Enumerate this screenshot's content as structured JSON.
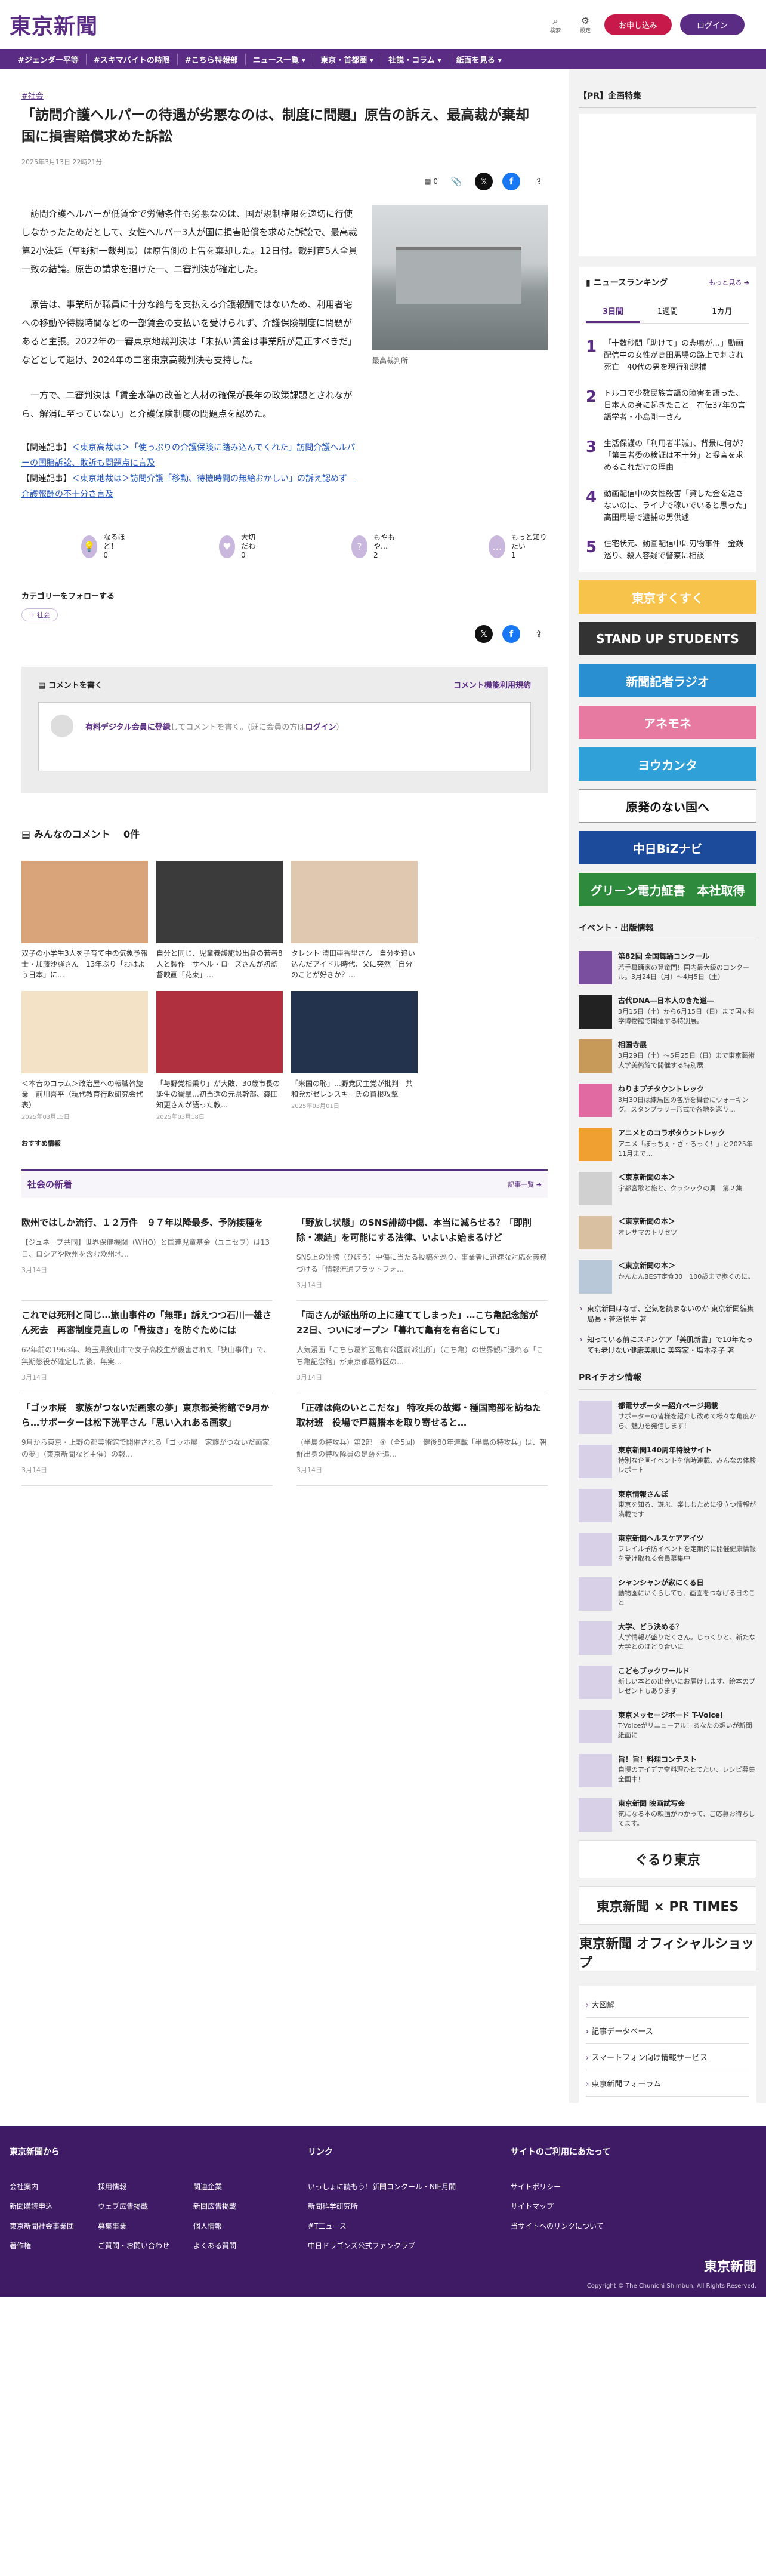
{
  "header": {
    "logo": "東京新聞",
    "search_label": "検索",
    "settings_label": "設定",
    "signup_label": "お申し込み",
    "login_label": "ログイン"
  },
  "nav": [
    "#ジェンダー平等",
    "#スキマバイトの時限",
    "#こちら特報部",
    "ニュース一覧 ▾",
    "東京・首都圏 ▾",
    "社説・コラム ▾",
    "紙面を見る ▾"
  ],
  "article": {
    "category": "#社会",
    "title": "「訪問介護ヘルパーの待遇が劣悪なのは、制度に問題」原告の訴え、最高裁が棄却　国に損害賠償求めた訴訟",
    "date": "2025年3月13日 22時21分",
    "comments_count": "0",
    "paragraphs": [
      "訪問介護ヘルパーが低賃金で労働条件も劣悪なのは、国が規制権限を適切に行使しなかったためだとして、女性ヘルパー3人が国に損害賠償を求めた訴訟で、最高裁第2小法廷（草野耕一裁判長）は原告側の上告を棄却した。12日付。裁判官5人全員一致の結論。原告の請求を退けた一、二審判決が確定した。",
      "原告は、事業所が職員に十分な給与を支払える介護報酬ではないため、利用者宅への移動や待機時間などの一部賃金の支払いを受けられず、介護保険制度に問題があると主張。2022年の一審東京地裁判決は「未払い賃金は事業所が是正すべきだ」などとして退け、2024年の二審東京高裁判決も支持した。",
      "一方で、二審判決は「賃金水準の改善と人材の確保が長年の政策課題とされながら、解消に至っていない」と介護保険制度の問題点を認めた。"
    ],
    "related": [
      {
        "prefix": "【関連記事】",
        "link": "＜東京高裁は＞「使っぷりの介護保険に踏み込んでくれた」訪問介護ヘルパーの国賠訴訟、敗訴も問題点に言及"
      },
      {
        "prefix": "【関連記事】",
        "link": "＜東京地裁は＞訪問介護「移動、待機時間の無給おかしい」の訴え認めず　介護報酬の不十分さ言及"
      }
    ],
    "photo_caption": "最高裁判所",
    "reactions": [
      {
        "icon": "💡",
        "label": "なるほど！",
        "count": "0"
      },
      {
        "icon": "♥",
        "label": "大切だね",
        "count": "0"
      },
      {
        "icon": "?",
        "label": "もやもや…",
        "count": "2"
      },
      {
        "icon": "…",
        "label": "もっと知りたい",
        "count": "1"
      }
    ],
    "follow_label": "カテゴリーをフォローする",
    "follow_tag": "+ 社会"
  },
  "comments": {
    "header": "コメントを書く",
    "policy": "コメント機能利用規約",
    "prompt_pre": "有料デジタル会員に登録",
    "prompt_mid": "してコメントを書く。(既に会員の方は",
    "prompt_login": "ログイン",
    "prompt_end": "）",
    "all_label": "みんなのコメント",
    "all_count": "0件"
  },
  "cards": [
    {
      "text": "双子の小学生3人を子育て中の気象予報士・加藤沙羅さん　13年ぶり「おはよう日本」に…",
      "date": "",
      "color": "#d9a47a"
    },
    {
      "text": "自分と同じ、児童養護施設出身の若者8人と製作　サヘル・ローズさんが初監督映画「花束」…",
      "date": "",
      "color": "#3b3b3b"
    },
    {
      "text": "タレント 清田亜香里さん　自分を追い込んだアイドル時代、父に突然「自分のことが好きか？…",
      "date": "",
      "color": "#e0c8b0"
    },
    {
      "text": "＜本音のコラム＞政治屋への転職斡旋業　前川喜平（現代教育行政研究会代表）",
      "date": "2025年03月15日",
      "color": "#f3e2c6"
    },
    {
      "text": "「与野党相乗り」が大敗、30歳市長の誕生の衝撃…初当選の元県幹部、森田知更さんが語った教…",
      "date": "2025年03月18日",
      "color": "#b03040"
    },
    {
      "text": "「米国の恥」…野党民主党が批判　共和党がゼレンスキー氏の首根攻撃",
      "date": "2025年03月01日",
      "color": "#23324d"
    }
  ],
  "rec_label": "おすすめ情報",
  "latest": {
    "title": "社会の新着",
    "more": "記事一覧",
    "items": [
      {
        "title": "欧州ではしか流行、１２万件　９７年以降最多、予防接種を",
        "desc": "【ジュネーブ共同】世界保健機関（WHO）と国連児童基金（ユニセフ）は13日、ロシアや欧州を含む欧州地…",
        "date": "3月14日"
      },
      {
        "title": "「野放し状態」のSNS誹謗中傷、本当に減らせる？「即削除・凍結」を可能にする法律、いよいよ始まるけど",
        "desc": "SNS上の誹謗（ひぼう）中傷に当たる投稿を巡り、事業者に迅速な対応を義務づける「情報流通プラットフォ…",
        "date": "3月14日"
      },
      {
        "title": "これでは死刑と同じ…旅山事件の「無罪」訴えつつ石川一雄さん死去　再審制度見直しの「骨抜き」を防ぐためには",
        "desc": "62年前の1963年、埼玉県狭山市で女子高校生が殺害された「狭山事件」で、無期懲役が確定した後、無実…",
        "date": "3月14日"
      },
      {
        "title": "「両さんが派出所の上に建ててしまった」…こち亀記念館が22日、ついにオープン「暮れて亀有を有名にして」",
        "desc": "人気漫画「こちら葛飾区亀有公園前派出所」（こち亀）の世界観に浸れる「こち亀記念館」が東京都葛飾区の…",
        "date": "3月14日"
      },
      {
        "title": "「ゴッホ展　家族がつないだ画家の夢」東京都美術館で9月から…サポーターは松下洸平さん「思い入れある画家」",
        "desc": "9月から東京・上野の都美術館で開催される「ゴッホ展　家族がつないだ画家の夢」（東京新聞など主催）の報…",
        "date": "3月14日"
      },
      {
        "title": "「正確は俺のいとこだな」 特攻兵の故郷・種国南部を訪ねた取材班　役場で戸籍謄本を取り寄せると…",
        "desc": "（半島の特攻兵）第2部　④（全5回）　健後80年連載「半島の特攻兵」は、朝鮮出身の特攻隊員の足跡を追…",
        "date": "3月14日"
      }
    ]
  },
  "sidebar": {
    "pr_title": "【PR】企画特集",
    "ranking_title": "ニュースランキング",
    "ranking_more": "もっと見る",
    "tabs": [
      "3日間",
      "1週間",
      "1カ月"
    ],
    "ranking": [
      {
        "n": "1",
        "t": "「十数秒間「助けて」の悲鳴が…」動画配信中の女性が高田馬場の路上で刺され死亡　40代の男を現行犯逮捕"
      },
      {
        "n": "2",
        "t": "トルコで少数民族言語の障害を語った、日本人の身に起きたこと　在伝37年の言語学者・小島剛一さん"
      },
      {
        "n": "3",
        "t": "生活保護の「利用者半減」、背景に何が？「第三者委の検証は不十分」と提言を求めるこれだけの理由"
      },
      {
        "n": "4",
        "t": "動画配信中の女性殺害「貸した金を返さないのに、ライブで稼いでいると思った」　高田馬場で逮捕の男供述"
      },
      {
        "n": "5",
        "t": "住宅状元、動画配信中に刃物事件　金銭巡り、殺人容疑で警察に相談"
      }
    ],
    "banners": [
      {
        "label": "東京すくすく",
        "color": "#f7c34a"
      },
      {
        "label": "STAND UP STUDENTS",
        "color": "#333333"
      },
      {
        "label": "新聞記者ラジオ",
        "color": "#2a8fd1"
      },
      {
        "label": "アネモネ",
        "color": "#e77aa0"
      },
      {
        "label": "ヨウカンタ",
        "color": "#2fa0d8"
      },
      {
        "label": "原発のない国へ",
        "color": "#ffffff"
      },
      {
        "label": "中日BiZナビ",
        "color": "#1c4b9c"
      },
      {
        "label": "グリーン電力証書　本社取得",
        "color": "#2e8b3e"
      }
    ],
    "events_title": "イベント・出版情報",
    "events": [
      {
        "a": "第82回 全国舞踊コンクール",
        "b": "若手舞踊家の登竜門！国内最大級のコンクール。3月24日（月）～4月5日（土）"
      },
      {
        "a": "古代DNA―日本人のきた道―",
        "b": "3月15日（土）から6月15日（日）まで国立科学博物館で開催する特別展。"
      },
      {
        "a": "相国寺展",
        "b": "3月29日（土）～5月25日（日）まで東京藝術大学美術館で開催する特別展"
      },
      {
        "a": "ねりまプチタウントレック",
        "b": "3月30日は練馬区の各所を舞台にウォーキング。スタンプラリー形式で各地を巡り…"
      },
      {
        "a": "アニメとのコラボタウントレック",
        "b": "アニメ「ぽっちぇ・ざ・ろっく！」と2025年11月まで…"
      },
      {
        "a": "＜東京新聞の本＞",
        "b": "宇都宮歌と旅と、クラシックの勇　第２集"
      },
      {
        "a": "＜東京新聞の本＞",
        "b": "オレサマのトリセツ"
      },
      {
        "a": "＜東京新聞の本＞",
        "b": "かんたんBEST定食30　100歳まで歩くのに。"
      }
    ],
    "links": [
      "東京新聞はなぜ、空気を読まないのか 東京新聞編集局長・菅沼悦生 著",
      "知っている前にスキンケア「美肌新書」で10年たっても老けない健康美肌に 美容家・塩本孝子 著"
    ],
    "pr_info_title": "PRイチオシ情報",
    "pr": [
      {
        "a": "都電サポーター紹介ページ掲載",
        "b": "サポーターの皆様を紹介し改めて様々な角度から、魅力を発信します！"
      },
      {
        "a": "東京新聞140周年特設サイト",
        "b": "特別な企画イベントを信時連載、みんなの体験レポート"
      },
      {
        "a": "東京情報さんぽ",
        "b": "東京を知る、遊ぶ、楽しむために役立つ情報が満載です"
      },
      {
        "a": "東京新聞ヘルスケアアイツ",
        "b": "フレイル予防イベントを定期的に開催健康情報を受け取れる会員募集中"
      },
      {
        "a": "シャンシャンが家にくる日",
        "b": "動物園にいくらしても、画面をつなげる日のこと"
      },
      {
        "a": "大学、どう決める？",
        "b": "大学情報が盛りだくさん。じっくりと、新たな大学とのほどり合いに"
      },
      {
        "a": "こどもブックワールド",
        "b": "新しい本との出会いにお届けします、絵本のプレゼントもあります"
      },
      {
        "a": "東京メッセージボード T-Voice!",
        "b": "T-Voiceがリニューアル！あなたの想いが新聞紙面に"
      },
      {
        "a": "旨！旨！料理コンテスト",
        "b": "自慢のアイデア空料理ひとてたい、レシピ募集全国中！"
      },
      {
        "a": "東京新聞 映画試写会",
        "b": "気になる本の映画がわかって、ご応募お待ちしてます。"
      }
    ],
    "big_banners": [
      "ぐるり東京",
      "東京新聞 × PR TIMES",
      "東京新聞 オフィシャルショップ"
    ],
    "list": [
      "大図解",
      "記事データベース",
      "スマートフォン向け情報サービス",
      "東京新聞フォーラム"
    ]
  },
  "footer": {
    "col1_title": "東京新聞から",
    "col1": [
      "会社案内",
      "新聞購読申込",
      "東京新聞社会事業団",
      "著作権",
      "採用情報",
      "ウェブ広告掲載",
      "募集事業",
      "ご質問・お問い合わせ",
      "関連企業",
      "新聞広告掲載",
      "個人情報",
      "よくある質問"
    ],
    "col2_title": "リンク",
    "col2": [
      "いっしょに読もう！新聞コンクール・NIE月間",
      "新聞科学研究所",
      "#T二ュース",
      "中日ドラゴンズ公式ファンクラブ"
    ],
    "col3_title": "サイトのご利用にあたって",
    "col3": [
      "サイトポリシー",
      "サイトマップ",
      "当サイトへのリンクについて"
    ],
    "logo": "東京新聞",
    "copyright": "Copyright © The Chunichi Shimbun, All Rights Reserved."
  },
  "colors": {
    "brand": "#5b2c83",
    "accent": "#c7194a"
  }
}
